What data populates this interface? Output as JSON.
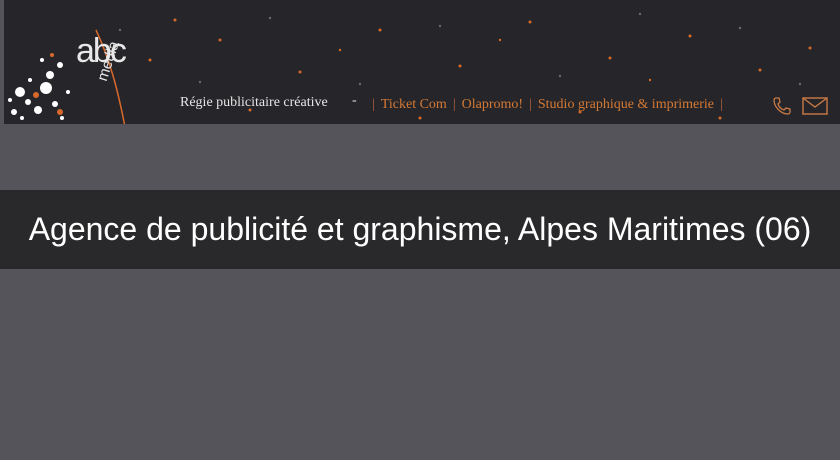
{
  "header": {
    "logo": {
      "line1": "abc",
      "line2": "media"
    },
    "tagline": "Régie publicitaire créative",
    "tagline_dash": "-",
    "nav": [
      {
        "label": "Ticket Com"
      },
      {
        "label": "Olapromo!"
      },
      {
        "label": "Studio graphique & imprimerie"
      }
    ],
    "phone_icon": "phone-icon",
    "mail_icon": "mail-icon"
  },
  "main": {
    "headline": "Agence de publicité et graphisme, Alpes Maritimes (06)"
  },
  "colors": {
    "banner_bg": "#25252a",
    "page_bg": "#55545a",
    "headline_band": "#29292b",
    "accent_orange": "#d57a35"
  }
}
